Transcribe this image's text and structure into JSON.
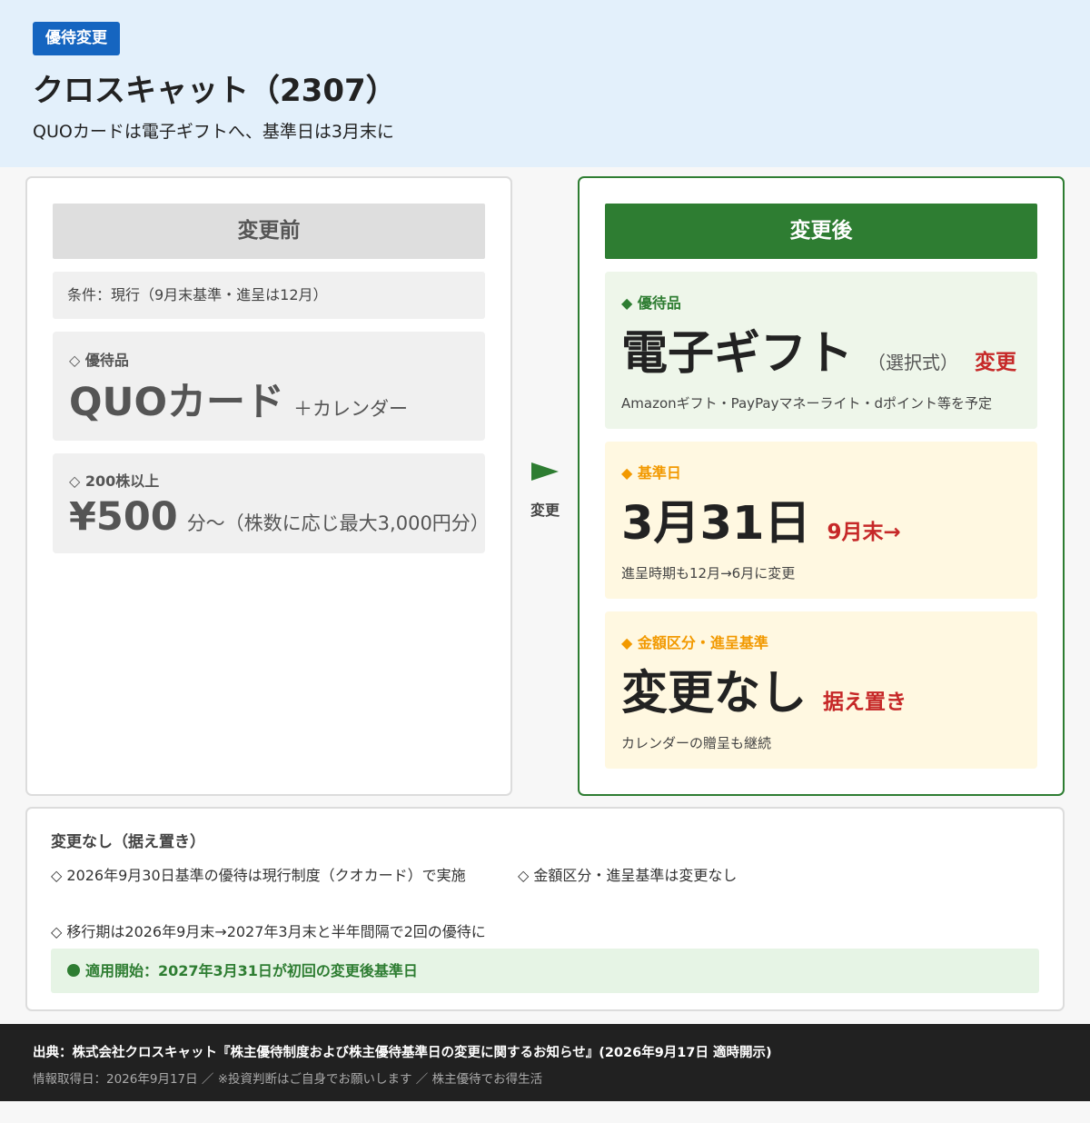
{
  "header": {
    "badge": "優待変更",
    "title": "クロスキャット（2307）",
    "subtitle": "QUOカードは電子ギフトへ、基準日は3月末に"
  },
  "before": {
    "heading": "変更前",
    "condition": "条件：現行（9月末基準・進呈は12月）",
    "item_label": "◇ 優待品",
    "item_value": "QUOカード",
    "item_suffix": "＋カレンダー",
    "amount_label": "◇ 200株以上",
    "amount_value": "¥500",
    "amount_suffix": "分〜（株数に応じ最大3,000円分）"
  },
  "arrow": {
    "label": "変更"
  },
  "after": {
    "heading": "変更後",
    "item": {
      "label": "◆ 優待品",
      "value": "電子ギフト",
      "paren": "（選択式）",
      "tag": "変更",
      "note": "Amazonギフト・PayPayマネーライト・dポイント等を予定"
    },
    "record_date": {
      "label": "◆ 基準日",
      "value": "3月31日",
      "tag": "9月末→",
      "note": "進呈時期も12月→6月に変更"
    },
    "criteria": {
      "label": "◆ 金額区分・進呈基準",
      "value": "変更なし",
      "tag": "据え置き",
      "note": "カレンダーの贈呈も継続"
    }
  },
  "notes": {
    "title": "変更なし（据え置き）",
    "items": [
      "◇ 2026年9月30日基準の優待は現行制度（クオカード）で実施",
      "◇ 金額区分・進呈基準は変更なし",
      "◇ 移行期は2026年9月末→2027年3月末と半年間隔で2回の優待に"
    ],
    "apply": "適用開始：2027年3月31日が初回の変更後基準日"
  },
  "footer": {
    "source": "出典：株式会社クロスキャット『株主優待制度および株主優待基準日の変更に関するお知らせ』(2026年9月17日 適時開示)",
    "meta": "情報取得日：2026年9月17日 ／ ※投資判断はご自身でお願いします ／ 株主優待でお得生活"
  },
  "colors": {
    "header_bg": "#e3f0fb",
    "badge": "#1565c0",
    "after_accent": "#2e7d32",
    "date_accent": "#f29900",
    "change_red": "#c62828",
    "footer_bg": "#212121"
  }
}
